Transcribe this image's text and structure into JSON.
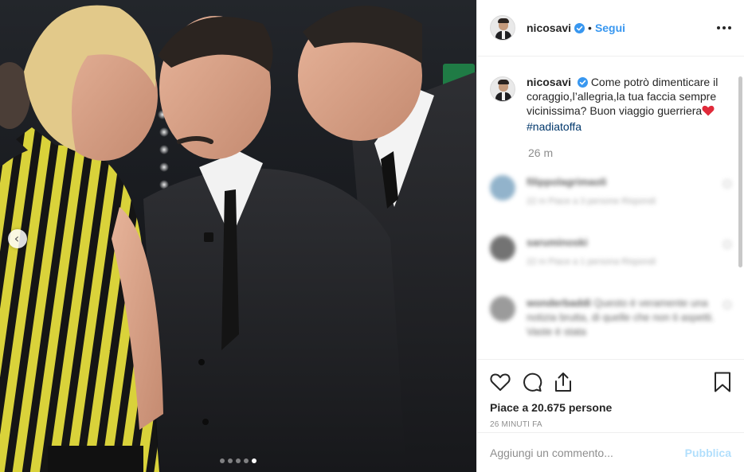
{
  "post": {
    "username": "nicosavi",
    "follow_label": "Segui",
    "separator": "•",
    "caption": {
      "username": "nicosavi",
      "text": "Come potrò dimenticare il coraggio,l’allegria,la tua faccia sempre vicinissima? Buon viaggio guerriera",
      "hashtag": "#nadiatoffa",
      "time": "26 m"
    },
    "likes_text": "Piace a 20.675 persone",
    "timestamp": "26 MINUTI FA",
    "comment_placeholder": "Aggiungi un commento...",
    "publish_label": "Pubblica"
  },
  "blurred_comments": [
    {
      "user": "filippolagrimaoli",
      "meta": "22 m   Piace a 3 persone   Rispondi"
    },
    {
      "user": "saruminoski",
      "meta": "22 m   Piace a 1 persona   Rispondi"
    },
    {
      "user": "wonderbaddi",
      "text": "Questo è veramente una notizia brutta, di quelle che non ti aspetti. Vaste è stata",
      "meta": ""
    }
  ],
  "carousel": {
    "total": 5,
    "active_index": 4
  },
  "icons": [
    "chevron-left-icon",
    "verified-badge-icon",
    "more-options-icon",
    "heart-icon",
    "comment-icon",
    "share-icon",
    "bookmark-icon",
    "red-heart-emoji-icon"
  ],
  "colors": {
    "accent": "#3897f0",
    "verified": "#3897f0",
    "hashtag": "#00376b",
    "publish_disabled": "#b2dffc",
    "muted": "#8e8e8e"
  }
}
